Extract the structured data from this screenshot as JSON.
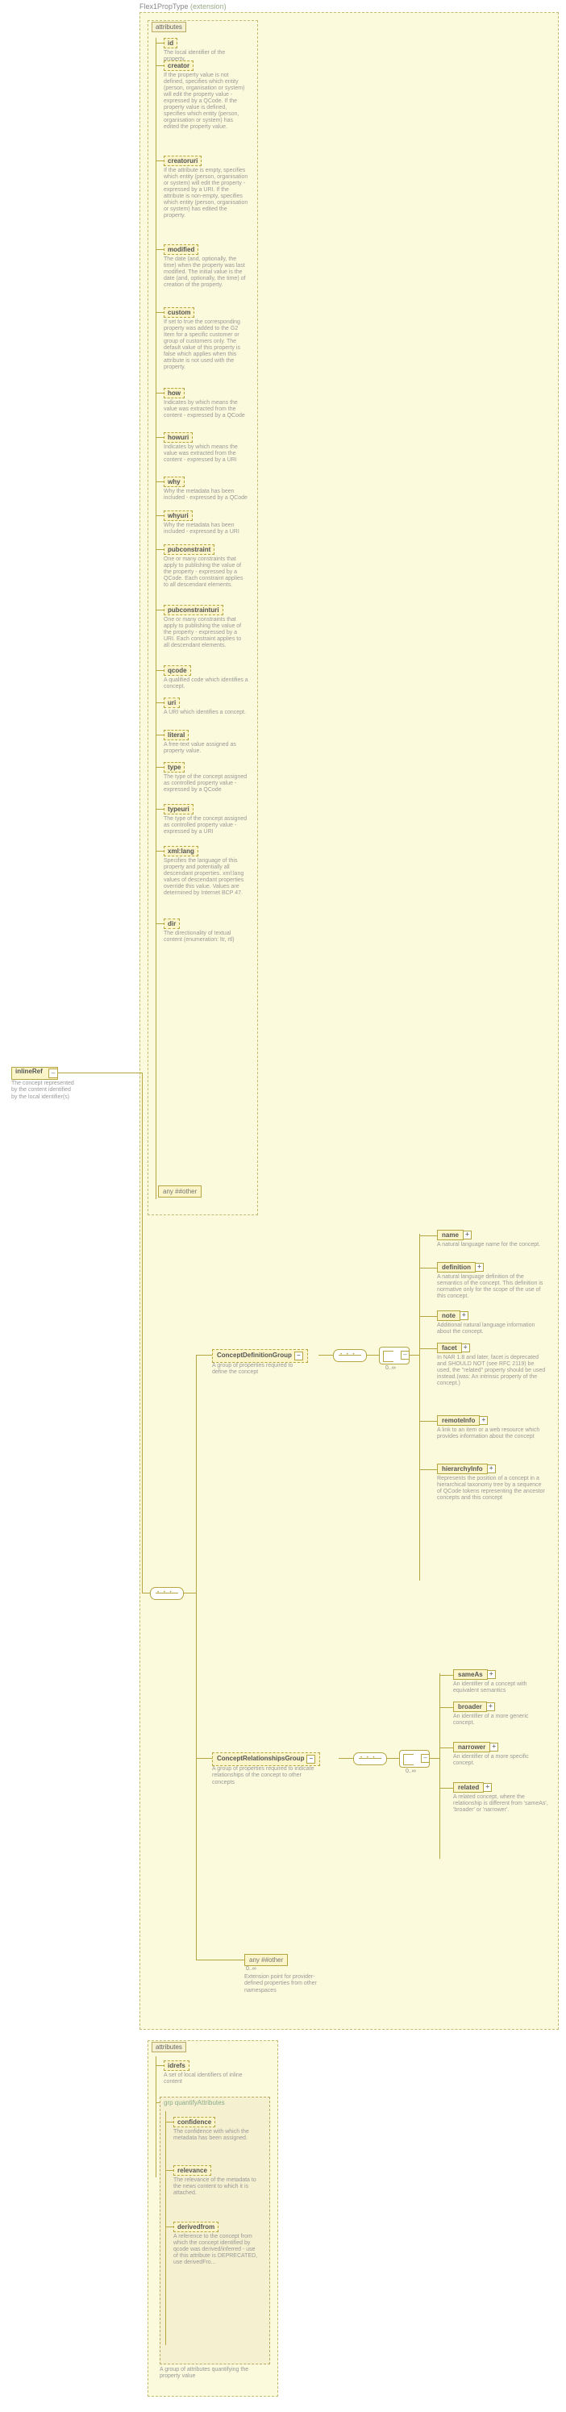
{
  "header": {
    "typeName": "Flex1PropType",
    "typeContext": "(extension)"
  },
  "root": {
    "name": "inlineRef",
    "desc": "The concept represented by the content identified by the local identifier(s)"
  },
  "attrHeader": "attributes",
  "attrs": [
    {
      "name": "id",
      "desc": "The local identifier of the property."
    },
    {
      "name": "creator",
      "desc": "If the property value is not defined, specifies which entity (person, organisation or system) will edit the property value - expressed by a QCode. If the property value is defined, specifies which entity (person, organisation or system) has edited the property value."
    },
    {
      "name": "creatoruri",
      "desc": "If the attribute is empty, specifies which entity (person, organisation or system) will edit the property - expressed by a URI. If the attribute is non-empty, specifies which entity (person, organisation or system) has edited the property."
    },
    {
      "name": "modified",
      "desc": "The date (and, optionally, the time) when the property was last modified. The initial value is the date (and, optionally, the time) of creation of the property."
    },
    {
      "name": "custom",
      "desc": "If set to true the corresponding property was added to the G2 Item for a specific customer or group of customers only. The default value of this property is false which applies when this attribute is not used with the property."
    },
    {
      "name": "how",
      "desc": "Indicates by which means the value was extracted from the content - expressed by a QCode"
    },
    {
      "name": "howuri",
      "desc": "Indicates by which means the value was extracted from the content - expressed by a URI"
    },
    {
      "name": "why",
      "desc": "Why the metadata has been included - expressed by a QCode"
    },
    {
      "name": "whyuri",
      "desc": "Why the metadata has been included - expressed by a URI"
    },
    {
      "name": "pubconstraint",
      "desc": "One or many constraints that apply to publishing the value of the property - expressed by a QCode. Each constraint applies to all descendant elements."
    },
    {
      "name": "pubconstrainturi",
      "desc": "One or many constraints that apply to publishing the value of the property - expressed by a URI. Each constraint applies to all descendant elements."
    },
    {
      "name": "qcode",
      "desc": "A qualified code which identifies a concept."
    },
    {
      "name": "uri",
      "desc": "A URI which identifies a concept."
    },
    {
      "name": "literal",
      "desc": "A free-text value assigned as property value."
    },
    {
      "name": "type",
      "desc": "The type of the concept assigned as controlled property value - expressed by a QCode"
    },
    {
      "name": "typeuri",
      "desc": "The type of the concept assigned as controlled property value - expressed by a URI"
    },
    {
      "name": "xml:lang",
      "desc": "Specifies the language of this property and potentially all descendant properties. xml:lang values of descendant properties override this value. Values are determined by Internet BCP 47."
    },
    {
      "name": "dir",
      "desc": "The directionality of textual content (enumeration: ltr, rtl)"
    }
  ],
  "anyAttr": "any ##other",
  "groups": {
    "def": {
      "name": "ConceptDefinitionGroup",
      "desc": "A group of properties required to define the concept"
    },
    "rel": {
      "name": "ConceptRelationshipsGroup",
      "desc": "A group of properties required to indicate relationships of the concept to other concepts"
    }
  },
  "defElems": [
    {
      "name": "name",
      "desc": "A natural language name for the concept."
    },
    {
      "name": "definition",
      "desc": "A natural language definition of the semantics of the concept. This definition is normative only for the scope of the use of this concept."
    },
    {
      "name": "note",
      "desc": "Additional natural language information about the concept."
    },
    {
      "name": "facet",
      "desc": "In NAR 1.8 and later, facet is deprecated and SHOULD NOT (see RFC 2119) be used, the \"related\" property should be used instead.(was: An intrinsic property of the concept.)"
    },
    {
      "name": "remoteInfo",
      "desc": "A link to an item or a web resource which provides information about the concept"
    },
    {
      "name": "hierarchyInfo",
      "desc": "Represents the position of a concept in a hierarchical taxonomy tree by a sequence of QCode tokens representing the ancestor concepts and this concept"
    }
  ],
  "relElems": [
    {
      "name": "sameAs",
      "desc": "An identifier of a concept with equivalent semantics"
    },
    {
      "name": "broader",
      "desc": "An identifier of a more generic concept."
    },
    {
      "name": "narrower",
      "desc": "An identifier of a more specific concept."
    },
    {
      "name": "related",
      "desc": "A related concept, where the relationship is different from 'sameAs', 'broader' or 'narrower'."
    }
  ],
  "anyOther": {
    "label": "any ##other",
    "desc": "Extension point for provider-defined properties from other namespaces"
  },
  "idrefs": {
    "name": "idrefs",
    "desc": "A set of local identifiers of inline content"
  },
  "quantify": {
    "label": "grp quantifyAttributes",
    "items": [
      {
        "name": "confidence",
        "desc": "The confidence with which the metadata has been assigned."
      },
      {
        "name": "relevance",
        "desc": "The relevance of the metadata to the news content to which it is attached."
      },
      {
        "name": "derivedfrom",
        "desc": "A reference to the concept from which the concept identified by qcode was derived/inferred - use of this attribute is DEPRECATED, use derivedFro..."
      }
    ],
    "groupDesc": "A group of attributes quantifying the property value"
  },
  "card": {
    "zeroInf": "0..∞"
  }
}
